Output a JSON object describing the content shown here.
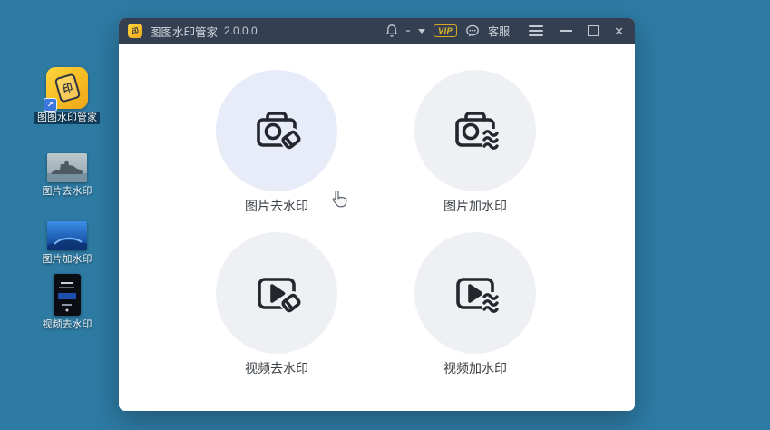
{
  "desktop": {
    "icons": [
      {
        "label": "图图水印管家",
        "kind": "app-shortcut",
        "icon": "watermark-app-icon"
      },
      {
        "label": "图片去水印",
        "kind": "image-file",
        "icon": "ship-photo-thumbnail"
      },
      {
        "label": "图片加水印",
        "kind": "image-file",
        "icon": "blue-photo-thumbnail"
      },
      {
        "label": "视频去水印",
        "kind": "video-file",
        "icon": "video-thumbnail"
      }
    ]
  },
  "window": {
    "title": "图图水印管家",
    "version": "2.0.0.0",
    "titlebar": {
      "vip_badge": "VIP",
      "support_label": "客服",
      "icons": [
        "bell-icon",
        "dropdown-caret-icon",
        "chat-bubble-icon",
        "menu-icon",
        "minimize-icon",
        "maximize-icon",
        "close-icon"
      ]
    },
    "features": [
      {
        "label": "图片去水印",
        "icon": "camera-erase-icon"
      },
      {
        "label": "图片加水印",
        "icon": "camera-waves-icon"
      },
      {
        "label": "视频去水印",
        "icon": "video-erase-icon"
      },
      {
        "label": "视频加水印",
        "icon": "video-waves-icon"
      }
    ],
    "colors": {
      "desktop_bg": "#2d7aa3",
      "titlebar_bg": "#343f51",
      "accent_yellow": "#f2b824",
      "vip_yellow": "#e9bc26",
      "circle_hover": "#e7ecf8",
      "circle_default": "#eef0f4",
      "icon_stroke": "#24282e"
    }
  }
}
